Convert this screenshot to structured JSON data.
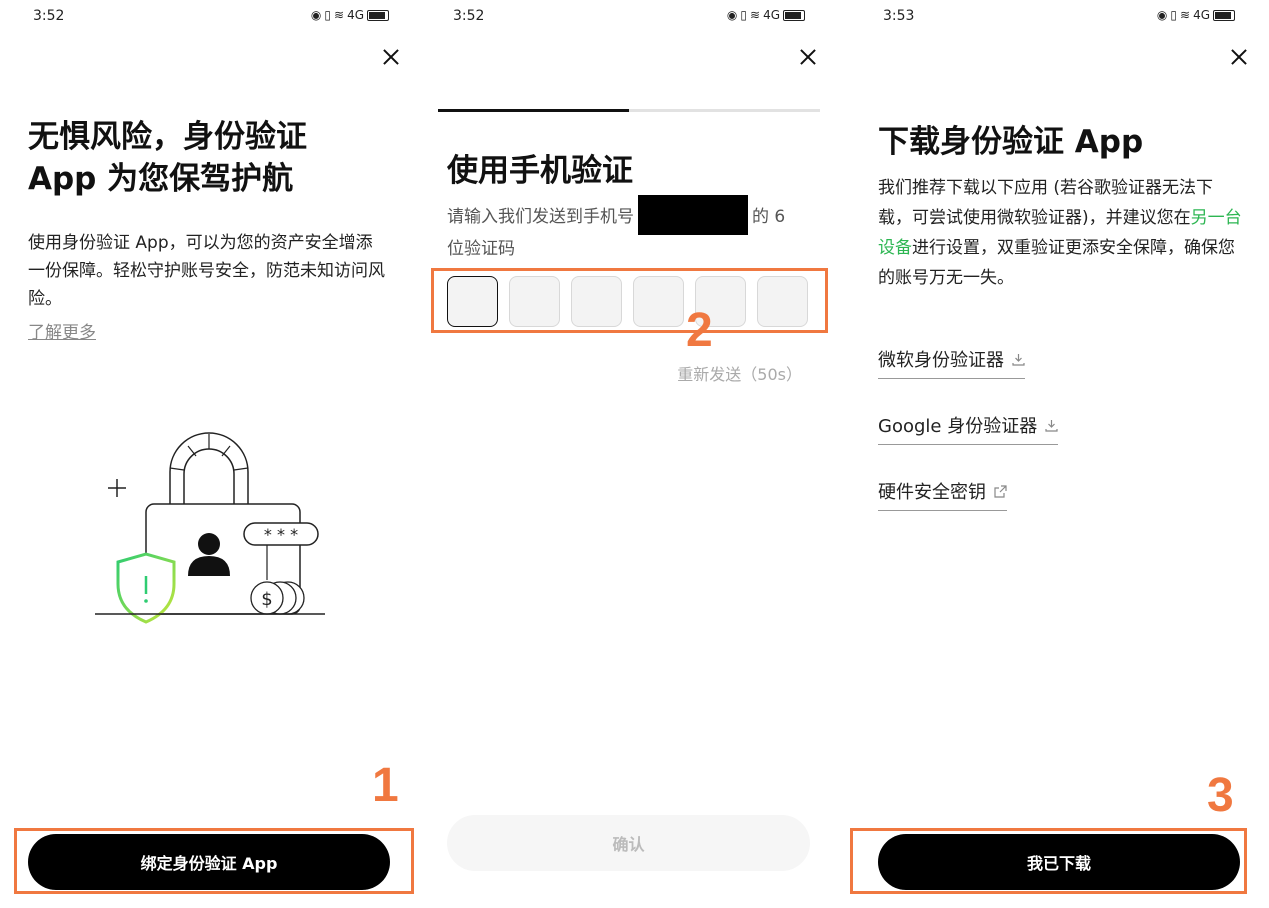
{
  "panels": [
    {
      "status": {
        "time": "3:52",
        "icons": [
          "eye-icon",
          "vibrate-icon",
          "wifi-icon",
          "signal-icon",
          "battery-icon"
        ],
        "signal_text": "4G"
      },
      "title": "无惧风险，身份验证 App 为您保驾护航",
      "description": "使用身份验证 App，可以为您的资产安全增添一份保障。轻松守护账号安全，防范未知访问风险。",
      "learn_more": "了解更多",
      "button": "绑定身份验证 App",
      "step": "1"
    },
    {
      "status": {
        "time": "3:52",
        "signal_text": "4G"
      },
      "progress": 0.5,
      "title": "使用手机验证",
      "description_before": "请输入我们发送到手机号",
      "description_after": "的 6 位验证码",
      "otp_count": 6,
      "resend": "重新发送（50s）",
      "button": "确认",
      "step": "2"
    },
    {
      "status": {
        "time": "3:53",
        "signal_text": "4G"
      },
      "title": "下载身份验证 App",
      "description_1": "我们推荐下载以下应用 (若谷歌验证器无法下载，可尝试使用微软验证器)，并建议您在",
      "description_link": "另一台设备",
      "description_2": "进行设置，双重验证更添安全保障，确保您的账号万无一失。",
      "items": [
        {
          "label": "微软身份验证器",
          "icon": "download-icon"
        },
        {
          "label": "Google 身份验证器",
          "icon": "download-icon"
        },
        {
          "label": "硬件安全密钥",
          "icon": "external-link-icon"
        }
      ],
      "button": "我已下载",
      "step": "3"
    }
  ],
  "colors": {
    "accent_highlight": "#f07840",
    "link_green": "#2db652",
    "shield_gradient": [
      "#2ecc71",
      "#c6e63a"
    ]
  }
}
